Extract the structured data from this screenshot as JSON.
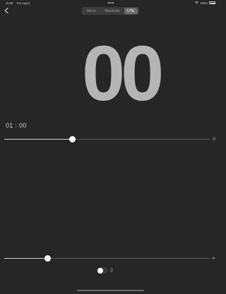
{
  "status_bar": {
    "time": "10:08",
    "date": "Tue Aug 5",
    "battery": "100%"
  },
  "nav": {
    "segments": [
      "Mirror",
      "Wardrobe",
      "UTIL"
    ],
    "selected_index": 2
  },
  "main": {
    "big_number": "00",
    "time_label": "01 : 00",
    "slider_top_value": 0.33,
    "slider_bottom_value": 0.21,
    "toggle_on": false
  },
  "colors": {
    "background": "#262626",
    "digits": "#b5b5b5",
    "accent": "#ffffff"
  },
  "icons": {
    "back": "chevron-left-icon",
    "slider_top_end": "brightness-icon",
    "slider_bottom_end": "volume-icon",
    "toggle_side": "microphone-icon"
  }
}
